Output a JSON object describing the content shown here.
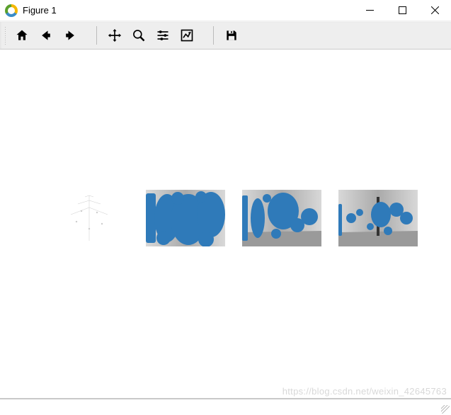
{
  "window": {
    "title": "Figure 1"
  },
  "toolbar": {
    "home_tooltip": "Reset original view",
    "back_tooltip": "Back to previous view",
    "forward_tooltip": "Forward to next view",
    "pan_tooltip": "Pan axes",
    "zoom_tooltip": "Zoom to rectangle",
    "configure_tooltip": "Configure subplots",
    "edit_tooltip": "Edit axis",
    "save_tooltip": "Save the figure"
  },
  "watermark": "https://blog.csdn.net/weixin_42645763",
  "chart_data": [
    {
      "type": "image",
      "subplot": 1,
      "description": "sparse light-gray scatter / line art silhouette on white",
      "overlay_color": null,
      "bg": "white"
    },
    {
      "type": "image",
      "subplot": 2,
      "description": "grayscale photo fully covered by dense blue blob overlay",
      "overlay_color": "#2f7ab9",
      "bg": "gray"
    },
    {
      "type": "image",
      "subplot": 3,
      "description": "grayscale photo with medium blue blob overlay concentrated center and right",
      "overlay_color": "#2f7ab9",
      "bg": "gray"
    },
    {
      "type": "image",
      "subplot": 4,
      "description": "grayscale photo with sparse blue blob overlay mostly center-right",
      "overlay_color": "#2f7ab9",
      "bg": "gray"
    }
  ]
}
